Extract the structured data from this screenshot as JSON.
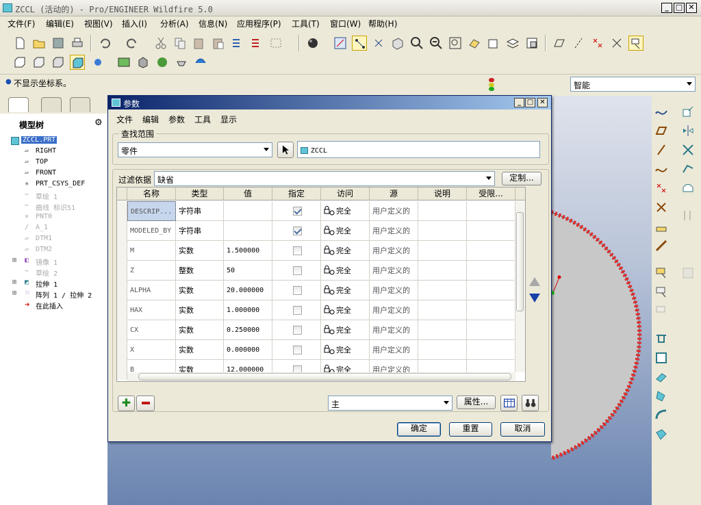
{
  "window": {
    "title": "ZCCL (活动的) - Pro/ENGINEER Wildfire 5.0"
  },
  "menu": [
    "文件(F)",
    "编辑(E)",
    "视图(V)",
    "插入(I)",
    "分析(A)",
    "信息(N)",
    "应用程序(P)",
    "工具(T)",
    "窗口(W)",
    "帮助(H)"
  ],
  "status": {
    "message": "不显示坐标系。",
    "filter_value": "智能"
  },
  "tree": {
    "title": "模型树",
    "items": [
      "ZCCL.PRT",
      "RIGHT",
      "TOP",
      "FRONT",
      "PRT_CSYS_DEF",
      "草绘 1",
      "曲线 标识51",
      "PNT0",
      "A_1",
      "DTM1",
      "DTM2",
      "镜像 1",
      "草绘 2",
      "拉伸 1",
      "阵列 1 / 拉伸 2",
      "在此插入"
    ]
  },
  "dialog": {
    "title": "参数",
    "menu": [
      "文件",
      "编辑",
      "参数",
      "工具",
      "显示"
    ],
    "scope_label": "查找范围",
    "scope_type": "零件",
    "scope_model": "ZCCL",
    "filter_label": "过滤依据",
    "filter_value": "缺省",
    "customize_label": "定制...",
    "columns": [
      "名称",
      "类型",
      "值",
      "指定",
      "访问",
      "源",
      "说明",
      "受限..."
    ],
    "rows": [
      {
        "name": "DESCRIP...",
        "type": "字符串",
        "value": "",
        "designate": true,
        "access": "完全",
        "source": "用户定义的"
      },
      {
        "name": "MODELED_BY",
        "type": "字符串",
        "value": "",
        "designate": true,
        "access": "完全",
        "source": "用户定义的"
      },
      {
        "name": "M",
        "type": "实数",
        "value": "1.500000",
        "designate": false,
        "access": "完全",
        "source": "用户定义的"
      },
      {
        "name": "Z",
        "type": "整数",
        "value": "50",
        "designate": false,
        "access": "完全",
        "source": "用户定义的"
      },
      {
        "name": "ALPHA",
        "type": "实数",
        "value": "20.000000",
        "designate": false,
        "access": "完全",
        "source": "用户定义的"
      },
      {
        "name": "HAX",
        "type": "实数",
        "value": "1.000000",
        "designate": false,
        "access": "完全",
        "source": "用户定义的"
      },
      {
        "name": "CX",
        "type": "实数",
        "value": "0.250000",
        "designate": false,
        "access": "完全",
        "source": "用户定义的"
      },
      {
        "name": "X",
        "type": "实数",
        "value": "0.000000",
        "designate": false,
        "access": "完全",
        "source": "用户定义的"
      },
      {
        "name": "B",
        "type": "实数",
        "value": "12.000000",
        "designate": false,
        "access": "完全",
        "source": "用户定义的"
      }
    ],
    "view_select": "主",
    "properties_label": "属性...",
    "ok_label": "确定",
    "reset_label": "重置",
    "cancel_label": "取消"
  }
}
